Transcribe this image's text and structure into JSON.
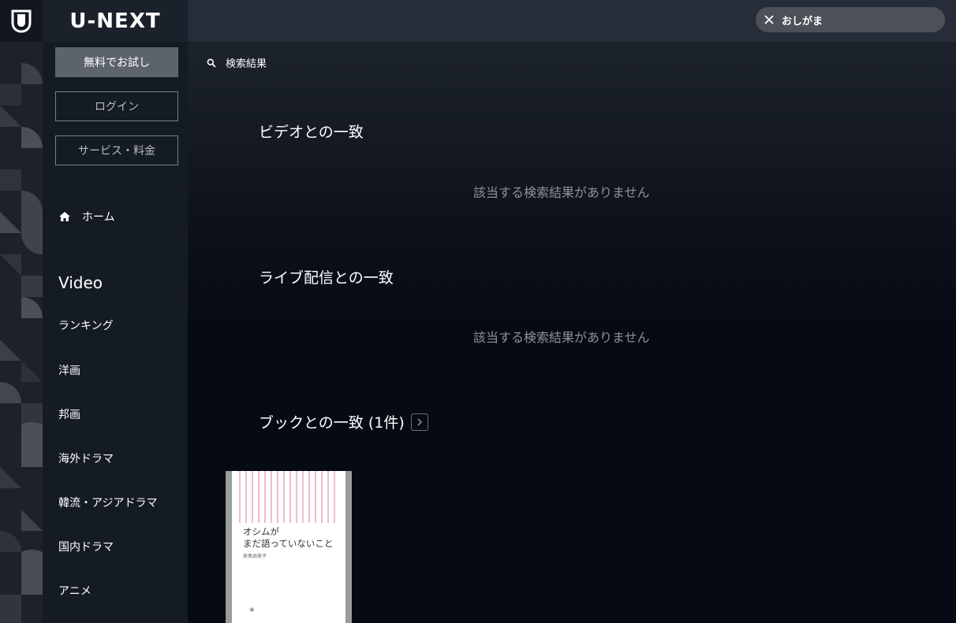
{
  "brand": {
    "name": "U-NEXT"
  },
  "search": {
    "query": "おしがま"
  },
  "sidebar": {
    "trial_button": "無料でお試し",
    "login_button": "ログイン",
    "service_button": "サービス・料金",
    "home": "ホーム",
    "section_title": "Video",
    "items": [
      "ランキング",
      "洋画",
      "邦画",
      "海外ドラマ",
      "韓流・アジアドラマ",
      "国内ドラマ",
      "アニメ"
    ]
  },
  "main": {
    "breadcrumb": "検索結果",
    "sections": [
      {
        "title": "ビデオとの一致",
        "empty_message": "該当する検索結果がありません"
      },
      {
        "title": "ライブ配信との一致",
        "empty_message": "該当する検索結果がありません"
      },
      {
        "title": "ブックとの一致 (1件)"
      }
    ],
    "book": {
      "title_line1": "オシムが",
      "title_line2": "まだ語っていないこと",
      "author": "原島由美子"
    }
  },
  "colors": {
    "accent_pink": "#e58fb4",
    "topbar": "#262d38",
    "sidebar": "#151b25",
    "background": "#050a14"
  }
}
